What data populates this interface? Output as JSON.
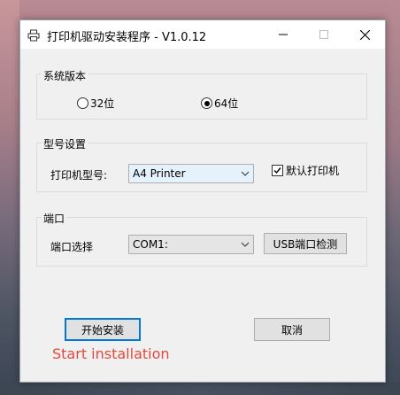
{
  "window": {
    "title": "打印机驱动安装程序 - V1.0.12"
  },
  "system_version": {
    "group_label": "系统版本",
    "options": [
      {
        "label": "32位",
        "checked": false
      },
      {
        "label": "64位",
        "checked": true
      }
    ]
  },
  "model_settings": {
    "group_label": "型号设置",
    "model_label": "打印机型号:",
    "model_value": "A4 Printer",
    "default_printer_label": "默认打印机",
    "default_printer_checked": true
  },
  "port": {
    "group_label": "端口",
    "port_label": "端口选择",
    "port_value": "COM1:",
    "usb_detect_label": "USB端口检测"
  },
  "actions": {
    "install_label": "开始安装",
    "cancel_label": "取消"
  },
  "annotation": {
    "text": "Start installation",
    "color": "#e4483c"
  },
  "colors": {
    "focus_accent": "#0078d7",
    "window_bg": "#f0f0f0"
  },
  "icons": {
    "app": "printer-icon",
    "minimize": "minimize-icon",
    "maximize": "maximize-icon",
    "close": "close-icon"
  }
}
